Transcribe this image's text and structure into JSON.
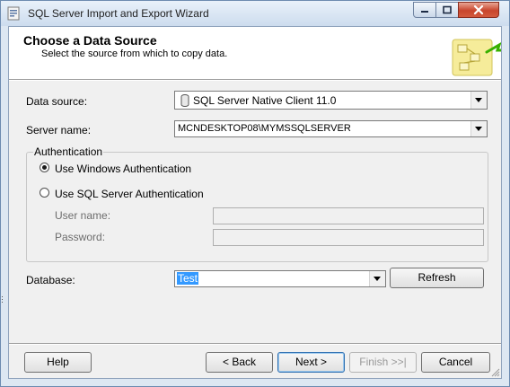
{
  "window": {
    "title": "SQL Server Import and Export Wizard"
  },
  "header": {
    "title": "Choose a Data Source",
    "subtitle": "Select the source from which to copy data."
  },
  "form": {
    "data_source": {
      "label": "Data source:",
      "value": "SQL Server Native Client 11.0"
    },
    "server_name": {
      "label": "Server name:",
      "value": "MCNDESKTOP08\\MYMSSQLSERVER"
    },
    "authentication": {
      "legend": "Authentication",
      "windows_label": "Use Windows Authentication",
      "sql_label": "Use SQL Server Authentication",
      "selected": "windows",
      "user_name_label": "User name:",
      "password_label": "Password:"
    },
    "database": {
      "label": "Database:",
      "value": "Test"
    },
    "refresh_label": "Refresh"
  },
  "footer": {
    "help_label": "Help",
    "back_label": "< Back",
    "next_label": "Next >",
    "finish_label": "Finish >>|",
    "cancel_label": "Cancel"
  },
  "colors": {
    "selection": "#3399ff",
    "title_bar": "#cddcee",
    "close_button": "#c8452c"
  },
  "icons": [
    "app-icon",
    "minimize-icon",
    "maximize-icon",
    "close-icon",
    "database-icon",
    "chevron-down-icon",
    "wizard-graphic-icon",
    "resize-grip-icon"
  ]
}
